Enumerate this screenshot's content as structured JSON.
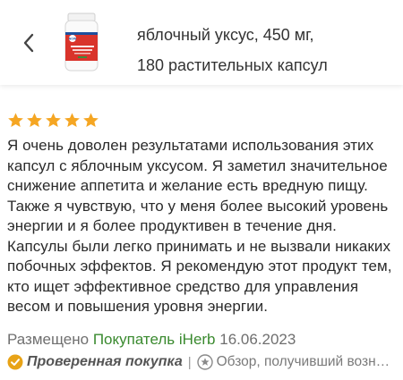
{
  "header": {
    "back_icon": "chevron-left-icon",
    "product_line1": "яблочный уксус, 450 мг,",
    "product_line2": "180 растительных капсул",
    "thumb_brand": "NOW",
    "thumb_label": "Apple Cider Vinegar"
  },
  "review": {
    "rating": 5,
    "rating_max": 5,
    "star_color": "#f5a623",
    "text": "Я очень доволен результатами использования этих капсул с яблочным уксусом. Я заметил значительное снижение аппетита и желание есть вредную пищу. Также я чувствую, что у меня более высокий уровень энергии и я более продуктивен в течение дня. Капсулы были легко принимать и не вызвали никаких побочных эффектов. Я рекомендую этот продукт тем, кто ищет эффективное средство для управления весом и повышения уровня энергии.",
    "posted_prefix": "Размещено",
    "buyer": "Покупатель iHerb",
    "date": "16.06.2023",
    "verified_label": "Проверенная покупка",
    "separator": "|",
    "reward_label": "Обзор, получивший возн…",
    "verified_color": "#e8a317",
    "buyer_color": "#3a8a2f"
  }
}
